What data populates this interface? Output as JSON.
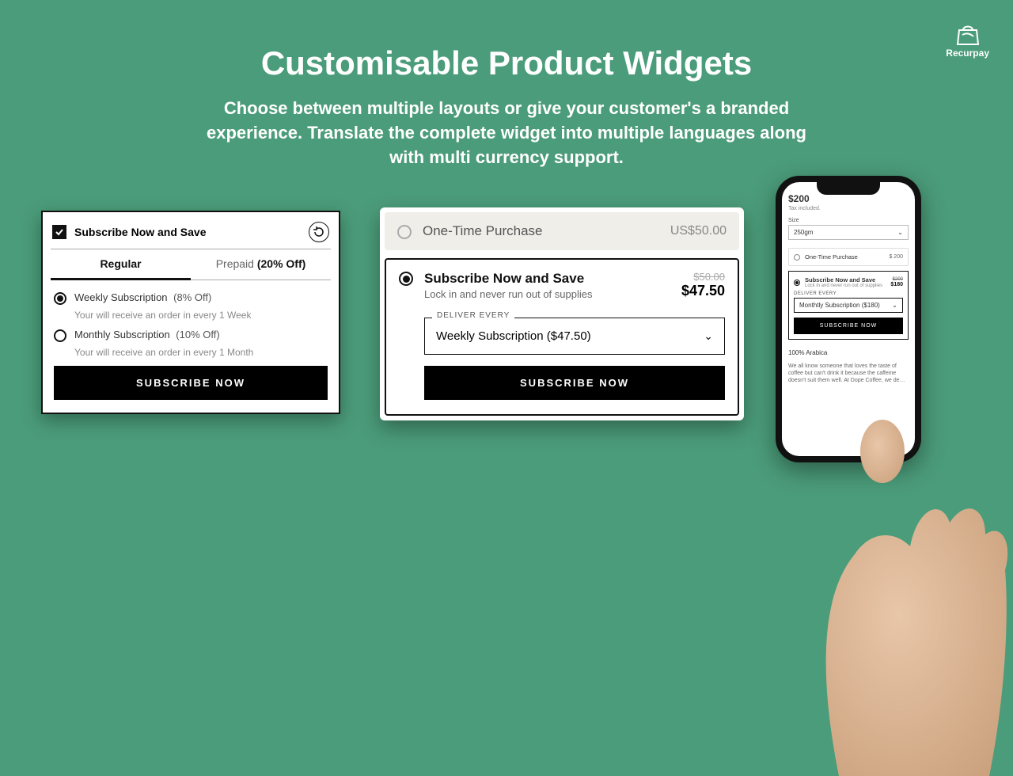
{
  "brand": {
    "name": "Recurpay"
  },
  "hero": {
    "title": "Customisable  Product Widgets",
    "subtitle": "Choose between multiple layouts or give your customer's a branded experience. Translate the complete widget into multiple languages along with multi currency support."
  },
  "widgetA": {
    "title": "Subscribe Now and Save",
    "tabs": {
      "regular": "Regular",
      "prepaid": "Prepaid",
      "prepaid_off": "(20% Off)"
    },
    "options": [
      {
        "name": "Weekly Subscription",
        "off": "(8% Off)",
        "desc": "Your will receive an order in every 1 Week",
        "selected": true
      },
      {
        "name": "Monthly Subscription",
        "off": "(10% Off)",
        "desc": "Your will receive an order in every 1 Month",
        "selected": false
      }
    ],
    "cta": "SUBSCRIBE NOW"
  },
  "widgetB": {
    "one_time": {
      "label": "One-Time Purchase",
      "price": "US$50.00"
    },
    "subscribe": {
      "title": "Subscribe Now and Save",
      "subtitle": "Lock in and never run out of supplies",
      "strike": "$50.00",
      "price": "$47.50",
      "deliver_label": "DELIVER EVERY",
      "select_value": "Weekly Subscription ($47.50)"
    },
    "cta": "SUBSCRIBE NOW"
  },
  "phone": {
    "price": "$200",
    "tax": "Tax included.",
    "size_label": "Size",
    "size_value": "250gm",
    "one_time": {
      "label": "One-Time Purchase",
      "price": "$ 200"
    },
    "subscribe": {
      "title": "Subscribe Now and Save",
      "subtitle": "Lock in and never run out of supplies",
      "strike": "$200",
      "price": "$180",
      "deliver_label": "DELIVER EVERY",
      "select_value": "Monthtly Subscription ($180)"
    },
    "cta": "SUBSCRIBE NOW",
    "desc_title": "100% Arabica",
    "desc_body": "We all know someone that loves the taste of coffee but can't drink it because the caffeine doesn't suit them well. At Dope Coffee, we de…"
  }
}
